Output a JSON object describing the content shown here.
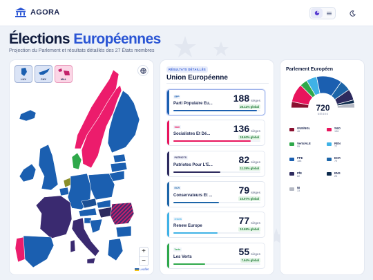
{
  "app": {
    "name": "AGORA"
  },
  "page": {
    "title_part1": "Élections",
    "title_part2": "Européennes",
    "subtitle": "Projection du Parlement et résultats détaillés des 27 États membres"
  },
  "colors": {
    "accent": "#2a55d4",
    "ppe": "#1b5fb0",
    "sd": "#e8145c",
    "pfe": "#2d2a5e",
    "ecr": "#1c65a8",
    "renew": "#3fb2e6",
    "verts": "#2ea84a",
    "gue": "#8a1030",
    "esn": "#0c2a4d",
    "ni": "#b5b9c4"
  },
  "map": {
    "mini_maps": [
      {
        "label": "LUX"
      },
      {
        "label": "CHY"
      },
      {
        "label": "MAL"
      }
    ],
    "zoom_in": "+",
    "zoom_out": "−",
    "attribution": "Leaflet"
  },
  "results": {
    "badge": "RÉSULTATS DÉTAILLÉS",
    "title": "Union Européenne",
    "seats_label": "sièges",
    "parties": [
      {
        "logo": "EPP",
        "name": "Parti Populaire Eu...",
        "seats": "188",
        "pct": "20.11% global",
        "share": 0.2011,
        "color": "#1b5fb0",
        "selected": true
      },
      {
        "logo": "S&D",
        "name": "Socialistes Et Dé...",
        "seats": "136",
        "pct": "18.60% global",
        "share": 0.186,
        "color": "#e8145c",
        "selected": false
      },
      {
        "logo": "PATRIOTS",
        "name": "Patriotes Pour L'E...",
        "seats": "82",
        "pct": "11.39% global",
        "share": 0.1139,
        "color": "#2d2a5e",
        "selected": false
      },
      {
        "logo": "ECR",
        "name": "Conservateurs Et ...",
        "seats": "79",
        "pct": "10.97% global",
        "share": 0.1097,
        "color": "#1c65a8",
        "selected": false
      },
      {
        "logo": "renew",
        "name": "Renew Europe",
        "seats": "77",
        "pct": "10.69% global",
        "share": 0.1069,
        "color": "#3fb2e6",
        "selected": false
      },
      {
        "logo": "Verts",
        "name": "Les Verts",
        "seats": "55",
        "pct": "7.64% global",
        "share": 0.0764,
        "color": "#2ea84a",
        "selected": false
      }
    ]
  },
  "parliament": {
    "title": "Parlement Européen",
    "total": "720",
    "total_label": "SIÈGES",
    "groups": [
      {
        "name": "GUE/NGL",
        "seats": "46",
        "color": "#8a1030"
      },
      {
        "name": "S&D",
        "seats": "136",
        "color": "#e8145c"
      },
      {
        "name": "Verts/ALE",
        "seats": "55",
        "color": "#2ea84a"
      },
      {
        "name": "REN",
        "seats": "77",
        "color": "#3fb2e6"
      },
      {
        "name": "PPE",
        "seats": "188",
        "color": "#1b5fb0"
      },
      {
        "name": "ECR",
        "seats": "79",
        "color": "#1c65a8"
      },
      {
        "name": "PfE",
        "seats": "82",
        "color": "#2d2a5e"
      },
      {
        "name": "ENS",
        "seats": "25",
        "color": "#0c2a4d"
      },
      {
        "name": "NI",
        "seats": "33",
        "color": "#b5b9c4"
      }
    ]
  }
}
